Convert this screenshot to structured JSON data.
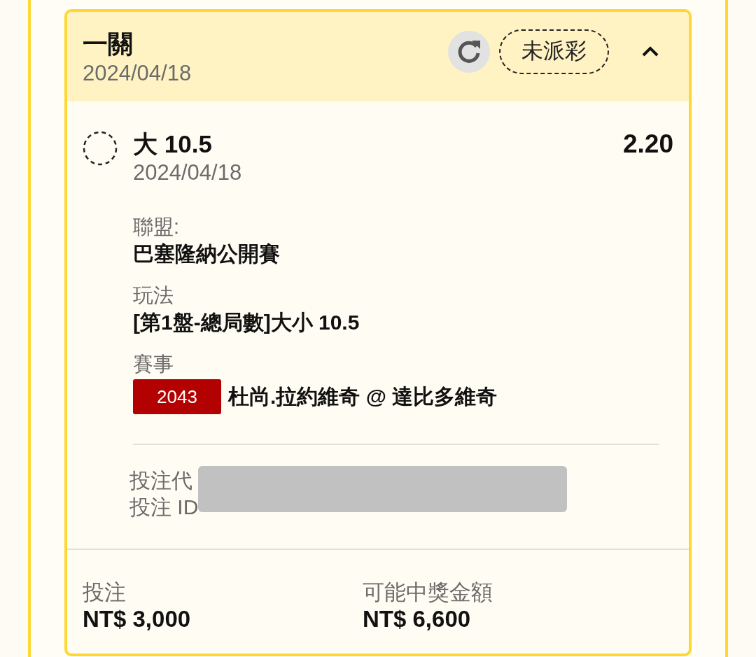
{
  "header": {
    "title": "一關",
    "date": "2024/04/18",
    "status": "未派彩",
    "expanded": true
  },
  "selection": {
    "name": "大 10.5",
    "odds": "2.20",
    "date": "2024/04/18"
  },
  "details": [
    {
      "label": "聯盟:",
      "value": "巴塞隆納公開賽"
    },
    {
      "label": "玩法",
      "value": "[第1盤-總局數]大小 10.5"
    },
    {
      "label": "賽事",
      "code": "2043",
      "value": "杜尚.拉約維奇 @ 達比多維奇"
    }
  ],
  "reference": {
    "lines": [
      "投注代",
      "投注 ID"
    ]
  },
  "footer": [
    {
      "label": "投注",
      "value": "NT$ 3,000"
    },
    {
      "label": "可能中獎金額",
      "value": "NT$ 6,600"
    }
  ]
}
